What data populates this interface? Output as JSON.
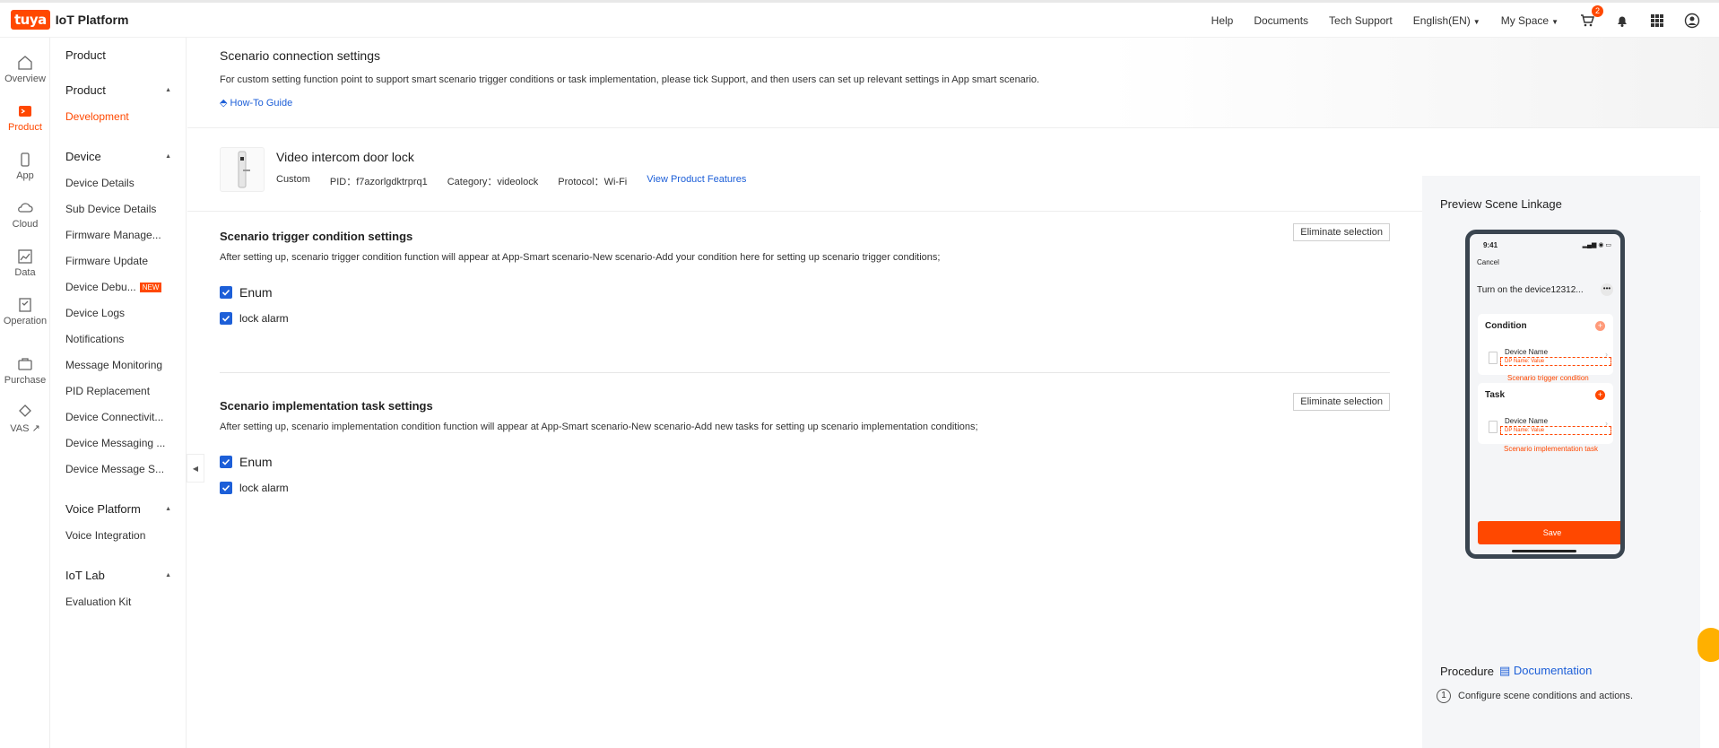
{
  "topbar": {
    "logo_text": "tuya",
    "title": "IoT Platform",
    "links": [
      "Help",
      "Documents",
      "Tech Support"
    ],
    "language": "English(EN)",
    "space": "My Space",
    "cart_count": "2"
  },
  "rail": [
    {
      "label": "Overview",
      "icon": "home-icon"
    },
    {
      "label": "Product",
      "icon": "product-icon",
      "active": true
    },
    {
      "label": "App",
      "icon": "app-icon"
    },
    {
      "label": "Cloud",
      "icon": "cloud-icon"
    },
    {
      "label": "Data",
      "icon": "data-icon"
    },
    {
      "label": "Operation",
      "icon": "operation-icon"
    },
    {
      "label": "Purchase",
      "icon": "purchase-icon"
    },
    {
      "label": "VAS ↗",
      "icon": "vas-icon"
    }
  ],
  "sidemenu": {
    "head": "Product",
    "groups": [
      {
        "title": "Product",
        "items": [
          "Development"
        ]
      },
      {
        "title": "Device",
        "items": [
          "Device Details",
          "Sub Device Details",
          "Firmware Manage...",
          "Firmware Update",
          "Device Debu...",
          "Device Logs",
          "Notifications",
          "Message Monitoring",
          "PID Replacement",
          "Device Connectivit...",
          "Device Messaging ...",
          "Device Message S..."
        ]
      },
      {
        "title": "Voice Platform",
        "items": [
          "Voice Integration"
        ]
      },
      {
        "title": "IoT Lab",
        "items": [
          "Evaluation Kit"
        ]
      }
    ],
    "new_tag": "NEW"
  },
  "hero": {
    "title": "Scenario connection settings",
    "desc": "For custom setting function point to support smart scenario trigger conditions or task implementation, please tick Support, and then users can set up relevant settings in App smart scenario.",
    "guide": "How-To Guide"
  },
  "product": {
    "name": "Video intercom door lock",
    "type": "Custom",
    "pid": "PID：f7azorlgdktrprq1",
    "category": "Category：videolock",
    "protocol": "Protocol：Wi-Fi",
    "features_link": "View Product Features"
  },
  "trigger": {
    "title": "Scenario trigger condition settings",
    "desc": "After setting up, scenario trigger condition function will appear at App-Smart scenario-New scenario-Add your condition here for setting up scenario trigger conditions;",
    "button": "Eliminate selection",
    "group_label": "Enum",
    "item_label": "lock alarm"
  },
  "task": {
    "title": "Scenario implementation task settings",
    "desc": "After setting up, scenario implementation condition function will appear at App-Smart scenario-New scenario-Add new tasks for setting up scenario implementation conditions;",
    "button": "Eliminate selection",
    "group_label": "Enum",
    "item_label": "lock alarm"
  },
  "preview": {
    "title": "Preview Scene Linkage",
    "time": "9:41",
    "cancel": "Cancel",
    "scene_name": "Turn on the device12312...",
    "dots": "•••",
    "condition_title": "Condition",
    "task_title": "Task",
    "device_name": "Device Name",
    "dp_placeholder": "DP Name: Value",
    "trigger_annot": "Scenario trigger condition",
    "task_annot": "Scenario implementation task",
    "save": "Save"
  },
  "procedure": {
    "title": "Procedure",
    "doc_link": "Documentation",
    "step1_num": "1",
    "step1": "Configure scene conditions and actions."
  },
  "colors": {
    "accent": "#ff4800",
    "link": "#1d5fd8"
  }
}
